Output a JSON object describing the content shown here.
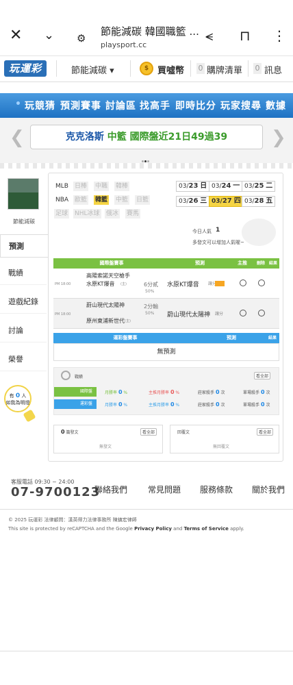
{
  "browser": {
    "title": "節能減碳 韓國職籃 ...",
    "url": "playsport.cc"
  },
  "site_nav": {
    "logo": "玩運彩",
    "user_menu": "節能減碳 ▾",
    "buy_coin": "買噓幣",
    "cart_count": "0",
    "cart_label": "購牌清單",
    "msg_count": "0",
    "msg_label": "訊息"
  },
  "main_nav": [
    "玩競猜",
    "預測賽事",
    "討論區",
    "找高手",
    "即時比分",
    "玩家搜尋",
    "數據"
  ],
  "banner": {
    "team": "克克洛斯",
    "league": "中籃",
    "text": "國際盤近21日49過39"
  },
  "profile": {
    "name": "節能減碳"
  },
  "left_tabs": [
    "預測",
    "戰績",
    "遊戲紀錄",
    "討論",
    "榮譽"
  ],
  "bulb": {
    "line1": "有",
    "count": "0",
    "unit": "人",
    "line2": "如我為明燈"
  },
  "leagues": {
    "row1": [
      "MLB",
      "日棒",
      "中職",
      "韓棒"
    ],
    "row2": [
      "NBA",
      "歐籃",
      "韓籃",
      "中籃",
      "日籃"
    ],
    "row3": [
      "足球",
      "NHL冰球",
      "俄冰",
      "賽馬"
    ]
  },
  "dates": [
    {
      "md": "03/",
      "d": "23",
      "w": "日"
    },
    {
      "md": "03/",
      "d": "24",
      "w": "一"
    },
    {
      "md": "03/",
      "d": "25",
      "w": "二"
    },
    {
      "md": "03/",
      "d": "26",
      "w": "三"
    },
    {
      "md": "03/",
      "d": "27",
      "w": "四"
    },
    {
      "md": "03/",
      "d": "28",
      "w": "五"
    }
  ],
  "popularity": {
    "label": "今日人氣",
    "value": "1",
    "hint": "多發文可以增加人氣喔~"
  },
  "intl_table": {
    "headers": [
      "國際盤賽事",
      "預測",
      "主推",
      "刪除",
      "結果"
    ],
    "rows": [
      {
        "time": "PM 18:00",
        "team1": "高陽索諾天空槍手",
        "team2": "水原KT爆音",
        "team2_sub": "(主)",
        "odds": "6分貳",
        "pct": "50%",
        "pick": "水原KT爆音",
        "pick_sub": "讓分"
      },
      {
        "time": "PM 18:00",
        "team1": "蔚山現代太陽神",
        "team2": "原州東浦新世代",
        "team2_sub": "(主)",
        "odds": "2分輸",
        "pct": "50%",
        "pick": "蔚山現代太陽神",
        "pick_sub": "讓分"
      }
    ]
  },
  "lottery_table": {
    "headers": [
      "運彩盤賽事",
      "預測",
      "結果"
    ],
    "empty": "無預測"
  },
  "stats": {
    "title": "戰績",
    "all": "看全部",
    "rows": [
      {
        "label": "國際盤",
        "winrate": "月勝率",
        "wr_val": "0",
        "main_rate": "主推月勝率",
        "main_val": "0",
        "month": "莊家殺手",
        "month_val": "0",
        "single": "單場殺手",
        "single_val": "0",
        "unit": "次"
      },
      {
        "label": "運彩盤",
        "winrate": "月勝率",
        "wr_val": "0",
        "main_rate": "主推月勝率",
        "main_val": "0",
        "month": "莊家殺手",
        "month_val": "0",
        "single": "單場殺手",
        "single_val": "0",
        "unit": "次"
      }
    ]
  },
  "posts": {
    "count": "0",
    "label": "篇發文",
    "all": "看全部",
    "empty": "無發文",
    "reply_label": "回覆文",
    "reply_all": "看全部",
    "reply_empty": "無回覆文"
  },
  "footer": {
    "service": "客服電話 09:30 ~ 24:00",
    "phone": "07-9700123",
    "links": [
      "聯絡我們",
      "常見問題",
      "服務條款",
      "關於我們"
    ],
    "copyright": "© 2025 玩運彩 法律顧問：漢英得力法律事務所 陳鎮宏律師",
    "recaptcha_pre": "This site is protected by reCAPTCHA and the Google ",
    "privacy": "Privacy Policy",
    "and": " and ",
    "terms": "Terms of Service",
    "apply": " apply."
  },
  "colors": {
    "nav_blue": "#1e72c3",
    "green": "#7ac142",
    "yellow": "#f5d443",
    "link_blue": "#1e88e5"
  }
}
